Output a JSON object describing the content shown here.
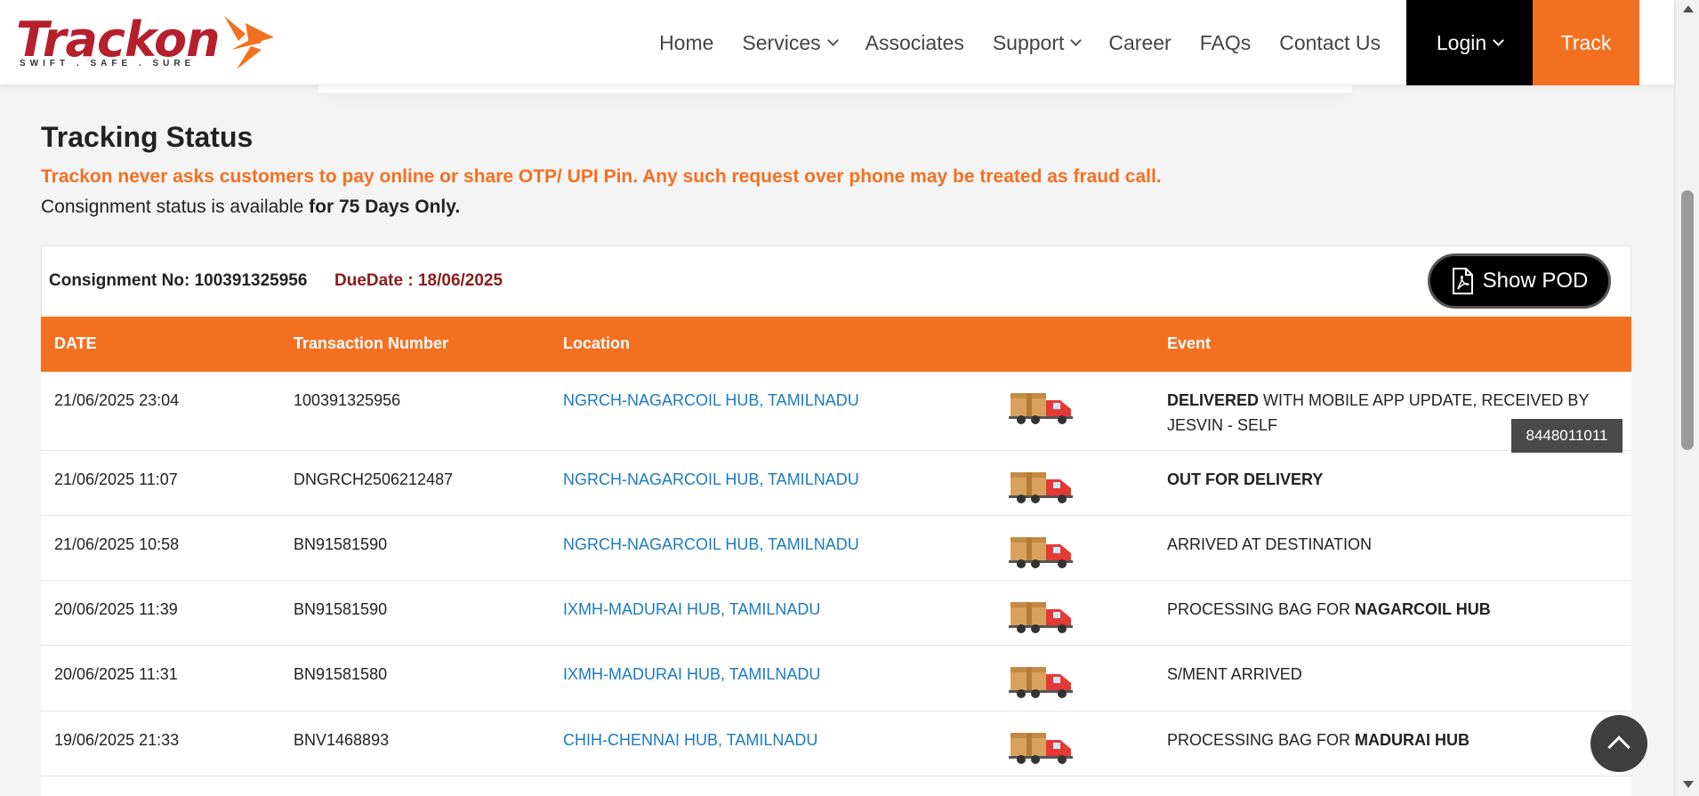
{
  "brand": {
    "name": "Trackon",
    "tagline": "SWIFT . SAFE . SURE",
    "primary_color": "#f37021",
    "logo_color": "#b5202d"
  },
  "nav": {
    "items": [
      {
        "label": "Home",
        "dropdown": false
      },
      {
        "label": "Services",
        "dropdown": true
      },
      {
        "label": "Associates",
        "dropdown": false
      },
      {
        "label": "Support",
        "dropdown": true
      },
      {
        "label": "Career",
        "dropdown": false
      },
      {
        "label": "FAQs",
        "dropdown": false
      },
      {
        "label": "Contact Us",
        "dropdown": false
      }
    ],
    "login_label": "Login",
    "track_label": "Track"
  },
  "page": {
    "title": "Tracking Status",
    "warning": "Trackon never asks customers to pay online or share OTP/ UPI Pin. Any such request over phone may be treated as fraud call.",
    "availability_prefix": "Consignment status is available ",
    "availability_bold": "for 75 Days Only."
  },
  "consignment": {
    "number_label": "Consignment No:",
    "number": "100391325956",
    "due_label": "DueDate :",
    "due_date": "18/06/2025",
    "show_pod_label": "Show POD"
  },
  "table": {
    "headers": {
      "date": "DATE",
      "transaction": "Transaction Number",
      "location": "Location",
      "event": "Event"
    },
    "rows": [
      {
        "date": "21/06/2025 23:04",
        "transaction": "100391325956",
        "location": "NGRCH-NAGARCOIL HUB, TAMILNADU",
        "event_bold": "DELIVERED",
        "event_text": " WITH MOBILE APP UPDATE, RECEIVED BY JESVIN - SELF"
      },
      {
        "date": "21/06/2025 11:07",
        "transaction": "DNGRCH2506212487",
        "location": "NGRCH-NAGARCOIL HUB, TAMILNADU",
        "event_bold": "OUT FOR DELIVERY",
        "event_text": ""
      },
      {
        "date": "21/06/2025 10:58",
        "transaction": "BN91581590",
        "location": "NGRCH-NAGARCOIL HUB, TAMILNADU",
        "event_bold": "",
        "event_text": "ARRIVED AT DESTINATION"
      },
      {
        "date": "20/06/2025 11:39",
        "transaction": "BN91581590",
        "location": "IXMH-MADURAI HUB, TAMILNADU",
        "event_text": "PROCESSING BAG FOR ",
        "event_bold_after": "NAGARCOIL HUB"
      },
      {
        "date": "20/06/2025 11:31",
        "transaction": "BN91581580",
        "location": "IXMH-MADURAI HUB, TAMILNADU",
        "event_bold": "",
        "event_text": "S/MENT ARRIVED"
      },
      {
        "date": "19/06/2025 21:33",
        "transaction": "BNV1468893",
        "location": "CHIH-CHENNAI HUB, TAMILNADU",
        "event_text": "PROCESSING BAG FOR ",
        "event_bold_after": "MADURAI HUB"
      }
    ]
  },
  "tooltip": {
    "text": "8448011011"
  }
}
